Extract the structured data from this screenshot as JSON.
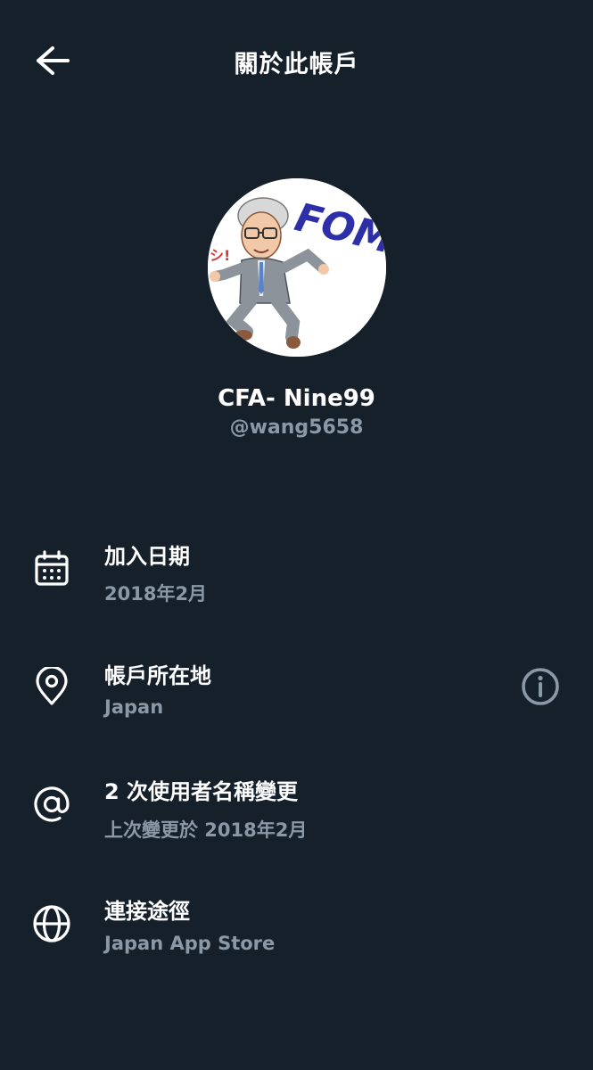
{
  "header": {
    "title": "關於此帳戶",
    "back_icon": "arrow-left-icon"
  },
  "profile": {
    "display_name": "CFA- Nine99",
    "handle": "@wang5658",
    "avatar_text": "FOMC",
    "avatar_caption": "シ!"
  },
  "rows": [
    {
      "icon": "calendar-icon",
      "title": "加入日期",
      "subtitle": "2018年2月"
    },
    {
      "icon": "location-pin-icon",
      "title": "帳戶所在地",
      "subtitle": "Japan",
      "action_icon": "info-icon"
    },
    {
      "icon": "at-sign-icon",
      "title": "2 次使用者名稱變更",
      "subtitle": "上次變更於 2018年2月"
    },
    {
      "icon": "globe-icon",
      "title": "連接途徑",
      "subtitle": "Japan App Store"
    }
  ],
  "colors": {
    "background": "#15202b",
    "primary_text": "#ffffff",
    "secondary_text": "#8b98a5"
  }
}
